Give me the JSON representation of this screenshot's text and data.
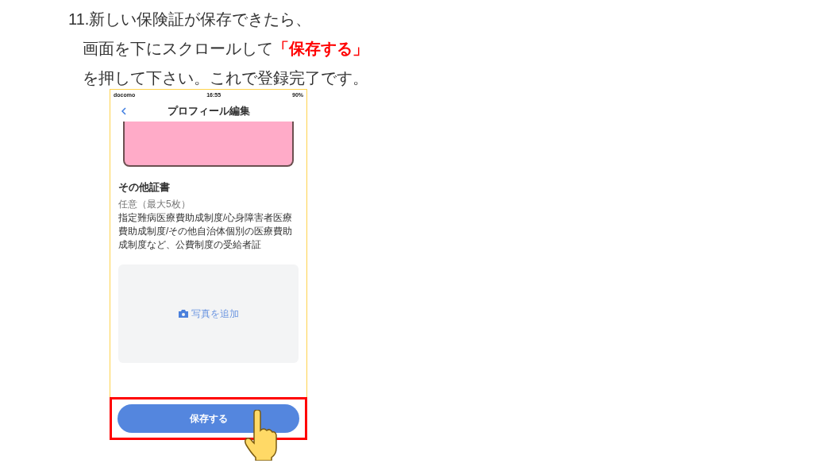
{
  "instruction": {
    "lines": [
      "11.新しい保険証が保存できたら、",
      "画面を下にスクロールして**「保存する」**",
      "を押して下さい。これで登録完了です。"
    ]
  },
  "phone": {
    "status_bar": {
      "carrier": "docomo",
      "time": "16:55",
      "battery": "90%"
    },
    "nav_title": "プロフィール編集",
    "section_title": "その他証書",
    "note": "任意（最大5枚）",
    "description": "指定難病医療費助成制度/心身障害者医療費助成制度/その他自治体個別の医療費助成制度など、公費制度の受給者証",
    "add_photo": "写真を追加",
    "save_button": "保存する"
  }
}
